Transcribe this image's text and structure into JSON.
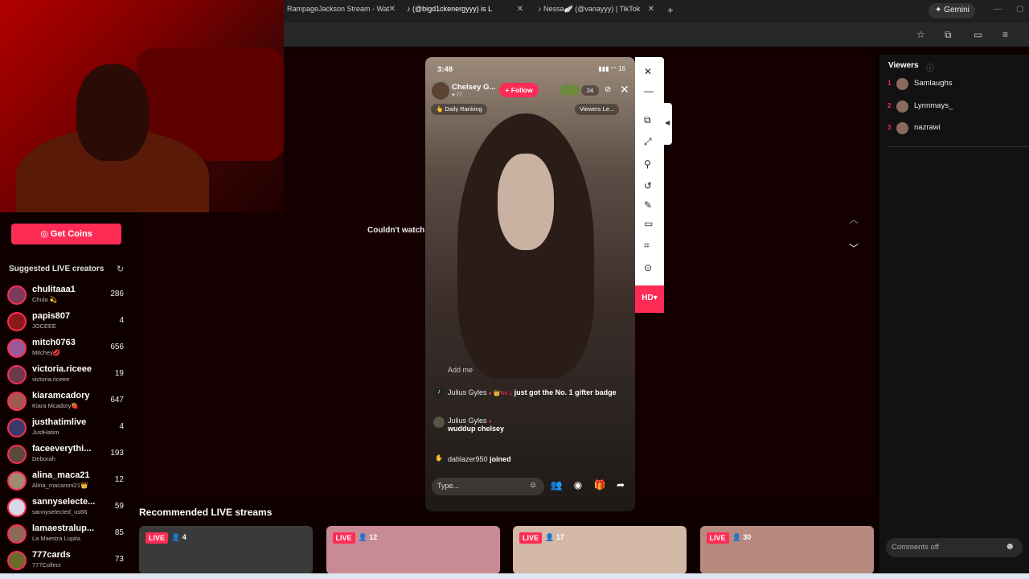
{
  "browser": {
    "tabs": [
      {
        "label": "RampageJackson Stream - Wat"
      },
      {
        "label": "(@bigd1ckenergyyy) is L"
      },
      {
        "label": "Nessa🪽 (@vanayyy) | TikTok"
      }
    ],
    "new_tab": "+",
    "gemini_label": "Gemini"
  },
  "sidebar": {
    "get_coins": "Get Coins",
    "suggested_title": "Suggested LIVE creators",
    "creators": [
      {
        "name": "chulitaaa1",
        "sub": "Chula 💫",
        "count": "286"
      },
      {
        "name": "papis807",
        "sub": "JOCEEE",
        "count": "4"
      },
      {
        "name": "mitch0763",
        "sub": "Mitchey💋",
        "count": "656"
      },
      {
        "name": "victoria.riceee",
        "sub": "victoria.riceee",
        "count": "19"
      },
      {
        "name": "kiaramcadory",
        "sub": "Kiara Mcadory🍓",
        "count": "647"
      },
      {
        "name": "justhatimlive",
        "sub": "JustHatim",
        "count": "4"
      },
      {
        "name": "faceeverythi...",
        "sub": "Deborah",
        "count": "193"
      },
      {
        "name": "alina_maca21",
        "sub": "Alina_macaroni21👑",
        "count": "12"
      },
      {
        "name": "sannyselecte...",
        "sub": "sannyselected_us66",
        "count": "59"
      },
      {
        "name": "lamaestralup...",
        "sub": "La Maestra Lupita",
        "count": "85"
      },
      {
        "name": "777cards",
        "sub": "777Collect",
        "count": "73"
      }
    ]
  },
  "main": {
    "couldnt_watch": "Couldn't watch",
    "recommended_title": "Recommended LIVE streams",
    "cards": [
      {
        "live": "LIVE",
        "count": "4",
        "color": "#3a3a3a"
      },
      {
        "live": "LIVE",
        "count": "12",
        "color": "#c88b95"
      },
      {
        "live": "LIVE",
        "count": "17",
        "color": "#d3b8a8"
      },
      {
        "live": "LIVE",
        "count": "30",
        "color": "#b78a80"
      }
    ]
  },
  "phone": {
    "time": "3:48",
    "status": "16",
    "name": "Chelsey G...",
    "likes": "♥ 77",
    "follow": "+ Follow",
    "viewer_count": "24",
    "daily_ranking": "Daily Ranking",
    "viewers_le": "Viewers Le...",
    "add_me": "Add me",
    "chat": [
      {
        "user": "Julius Gyles",
        "badge": "No.1",
        "msg": "just got the No. 1 gifter badge"
      },
      {
        "user": "Julius Gyles",
        "msg": "wuddup chelsey"
      },
      {
        "user": "dablazer950",
        "msg": "joined"
      }
    ],
    "input_placeholder": "Type..."
  },
  "side_toolbar": {
    "hd": "HD"
  },
  "viewers": {
    "title": "Viewers",
    "list": [
      {
        "rank": "1",
        "name": "Samlaughs"
      },
      {
        "rank": "2",
        "name": "Lynnmays_"
      },
      {
        "rank": "3",
        "name": "nazrawi"
      }
    ],
    "comments_off": "Comments off"
  }
}
